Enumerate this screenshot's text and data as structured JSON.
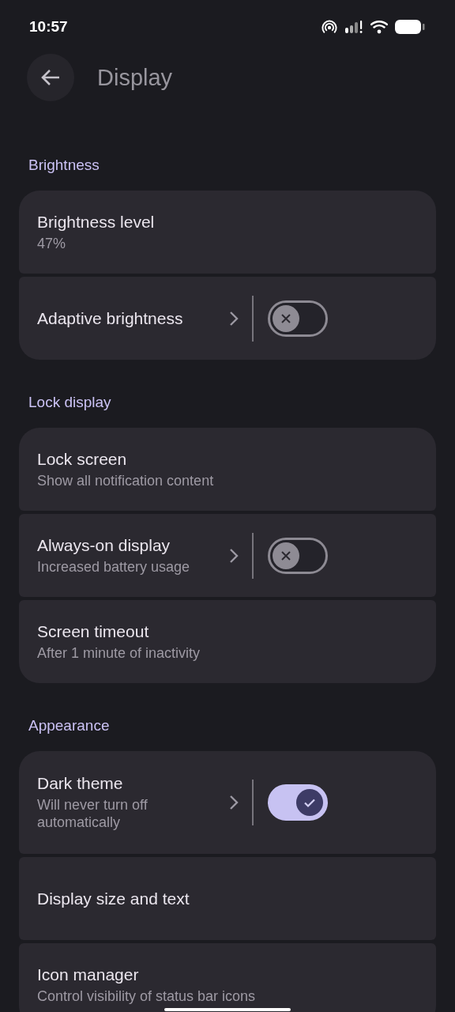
{
  "status_bar": {
    "time": "10:57"
  },
  "header": {
    "title": "Display"
  },
  "sections": [
    {
      "title": "Brightness",
      "items": [
        {
          "kind": "plain",
          "title": "Brightness level",
          "summary": "47%"
        },
        {
          "kind": "toggle",
          "title": "Adaptive brightness",
          "on": false
        }
      ]
    },
    {
      "title": "Lock display",
      "items": [
        {
          "kind": "plain",
          "title": "Lock screen",
          "summary": "Show all notification content"
        },
        {
          "kind": "toggle",
          "title": "Always-on display",
          "summary": "Increased battery usage",
          "on": false
        },
        {
          "kind": "plain",
          "title": "Screen timeout",
          "summary": "After 1 minute of inactivity"
        }
      ]
    },
    {
      "title": "Appearance",
      "items": [
        {
          "kind": "toggle",
          "title": "Dark theme",
          "summary": "Will never turn off automatically",
          "on": true
        },
        {
          "kind": "plain",
          "title": "Display size and text"
        },
        {
          "kind": "plain",
          "title": "Icon manager",
          "summary": "Control visibility of status bar icons"
        }
      ]
    }
  ]
}
